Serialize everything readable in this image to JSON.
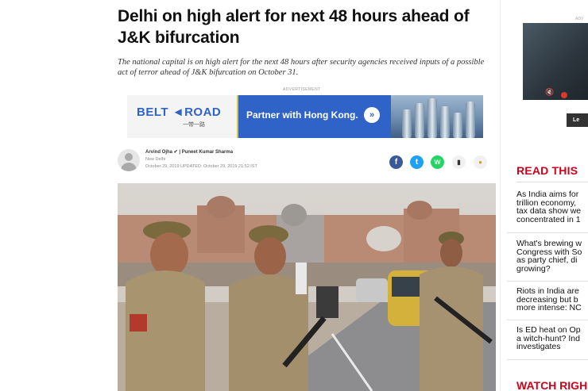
{
  "article": {
    "headline": "Delhi on high alert for next 48 hours ahead of J&K bifurcation",
    "summary": "The national capital is on high alert for the next 48 hours after security agencies received inputs of a possible act of terror ahead of J&K bifurcation on October 31.",
    "advertisement_label": "ADVERTISEMENT",
    "authors": "Arvind Ojha ✔ | Puneet Kumar Sharma",
    "location": "New Delhi",
    "dates": "October 29, 2019   UPDATED: October 29, 2019 21:52 IST"
  },
  "ad": {
    "logo_text": "BELT ◄ROAD",
    "logo_sub": "一带一路",
    "tagline": "Partner with Hong Kong.",
    "go_icon": "»"
  },
  "share": {
    "facebook": "f",
    "twitter": "t",
    "whatsapp": "w",
    "bookmark": "▮",
    "comment": "●"
  },
  "sidebar": {
    "ad_label": "ADV",
    "button_label": "Le",
    "read_this_title": "READ THIS",
    "stories": [
      [
        "As India aims for",
        "trillion economy,",
        "tax data show we",
        "concentrated in 1"
      ],
      [
        "What's brewing w",
        "Congress with So",
        "as party chief, di",
        "growing?"
      ],
      [
        "Riots in India are",
        "decreasing but b",
        "more intense: NC"
      ],
      [
        "Is ED heat on Op",
        "a witch-hunt? Ind",
        "investigates"
      ]
    ],
    "watch_right_title": "WATCH RIGH"
  },
  "colors": {
    "accent_red": "#d0021b",
    "ad_blue": "#2f63c8",
    "facebook": "#3b5998",
    "twitter": "#1da1f2",
    "whatsapp": "#25d366"
  }
}
